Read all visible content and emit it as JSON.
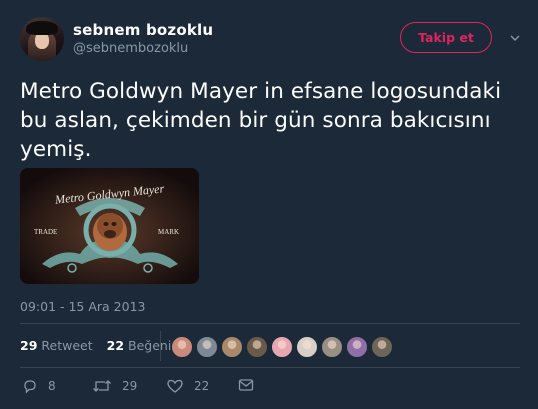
{
  "user": {
    "display_name": "sebnem bozoklu",
    "handle": "@sebnembozoklu"
  },
  "follow_button": {
    "label": "Takip et"
  },
  "tweet": {
    "text": "Metro Goldwyn Mayer in efsane logosundaki bu aslan, çekimden bir gün sonra bakıcısını yemiş.",
    "timestamp": "09:01 - 15 Ara 2013"
  },
  "media": {
    "logo_top": "Metro Goldwyn Mayer",
    "logo_left": "TRADE",
    "logo_right": "MARK"
  },
  "stats": {
    "retweets_count": "29",
    "retweets_label": "Retweet",
    "likes_count": "22",
    "likes_label": "Beğeni"
  },
  "likers": [
    {
      "color": "#c98a7a"
    },
    {
      "color": "#7d8a96"
    },
    {
      "color": "#a88a6a"
    },
    {
      "color": "#6b5a4a"
    },
    {
      "color": "#e6a7b0"
    },
    {
      "color": "#d8d0c8"
    },
    {
      "color": "#9a8f85"
    },
    {
      "color": "#8e6fa8"
    },
    {
      "color": "#6e6458"
    }
  ],
  "actions": {
    "reply_count": "8",
    "retweet_count": "29",
    "like_count": "22"
  },
  "colors": {
    "background": "#1c2938",
    "accent": "#e0245e",
    "muted": "#8899a6",
    "divider": "#38444d"
  }
}
